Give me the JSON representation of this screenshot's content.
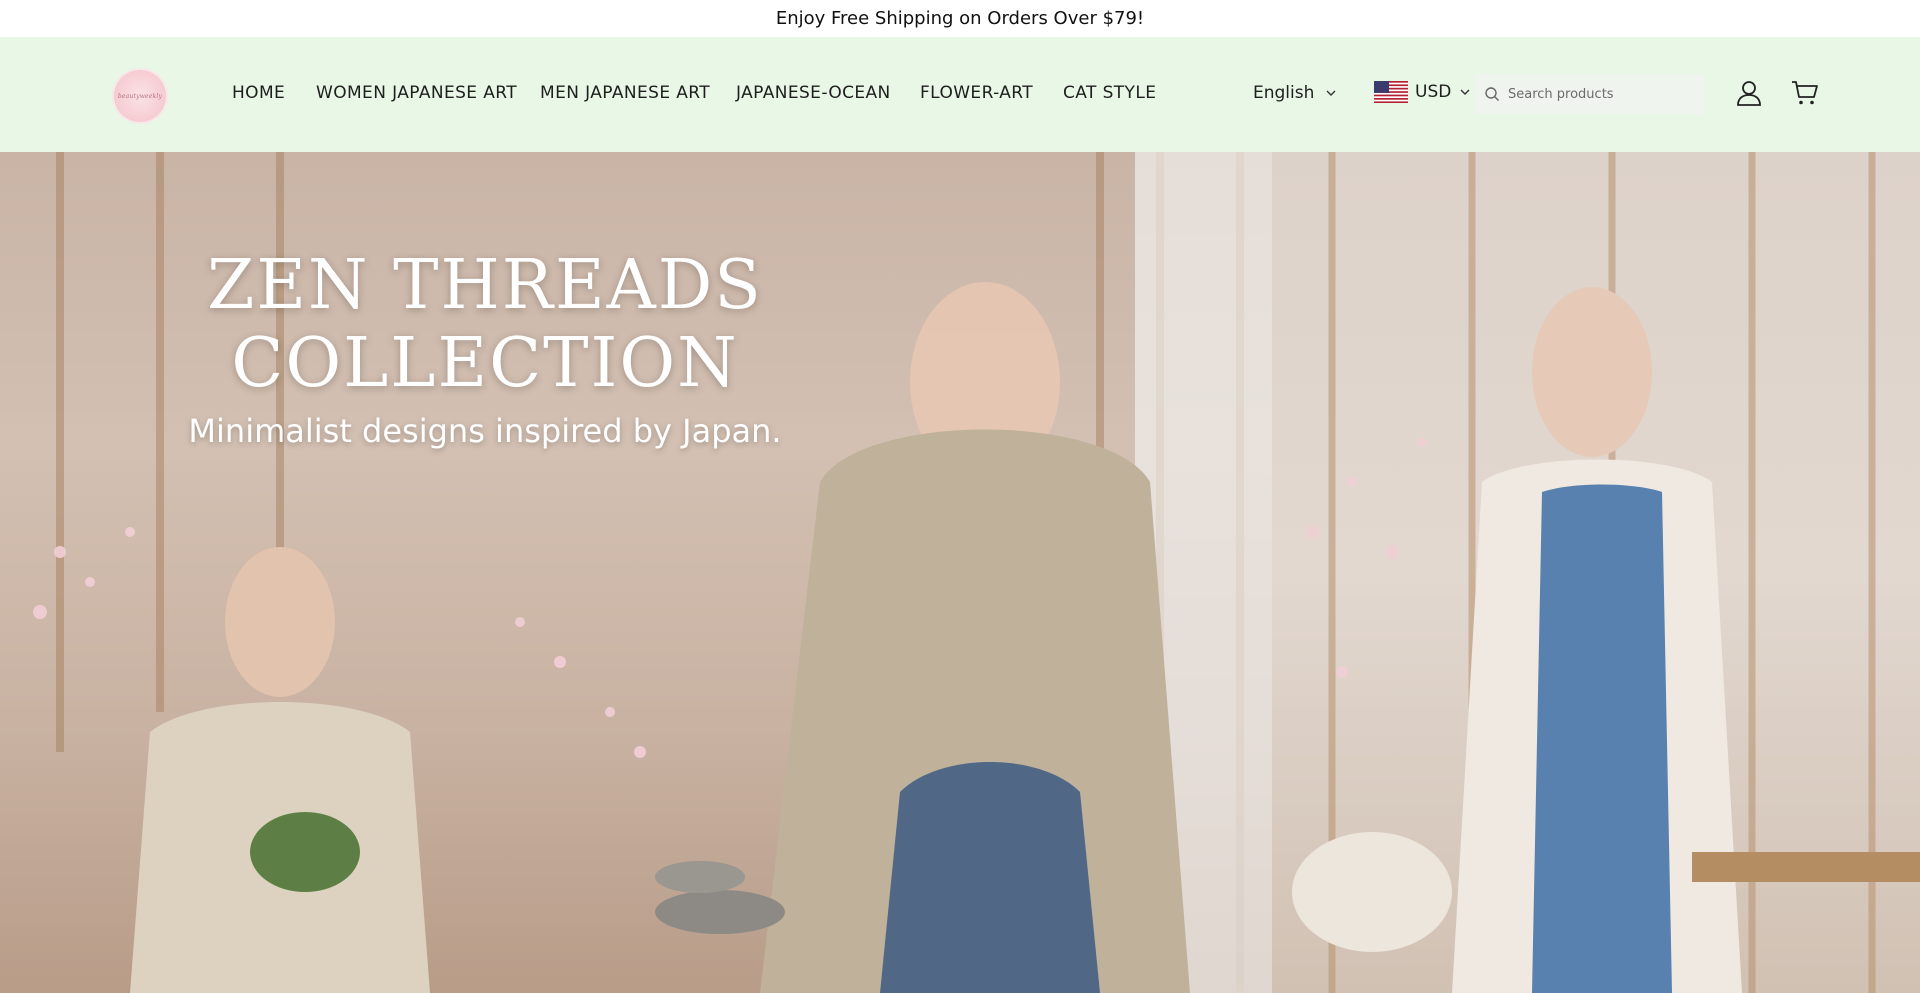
{
  "announcement": "Enjoy Free Shipping on Orders Over $79!",
  "logo_text": "beautyweekly",
  "nav": [
    {
      "label": "HOME"
    },
    {
      "label": "WOMEN JAPANESE ART"
    },
    {
      "label": "MEN JAPANESE ART"
    },
    {
      "label": "JAPANESE-OCEAN"
    },
    {
      "label": "FLOWER-ART"
    },
    {
      "label": "CAT STYLE"
    }
  ],
  "language": "English",
  "currency": "USD",
  "search": {
    "placeholder": "Search products"
  },
  "hero": {
    "title_line1": "ZEN THREADS",
    "title_line2": "COLLECTION",
    "subtitle": "Minimalist designs inspired by Japan."
  },
  "colors": {
    "header_bg": "#e8f7e6",
    "announcement_bg": "#ffffff",
    "text": "#1e1e1e"
  },
  "icons": [
    "logo",
    "chevron-down-icon",
    "us-flag-icon",
    "search-icon",
    "account-icon",
    "cart-icon"
  ]
}
